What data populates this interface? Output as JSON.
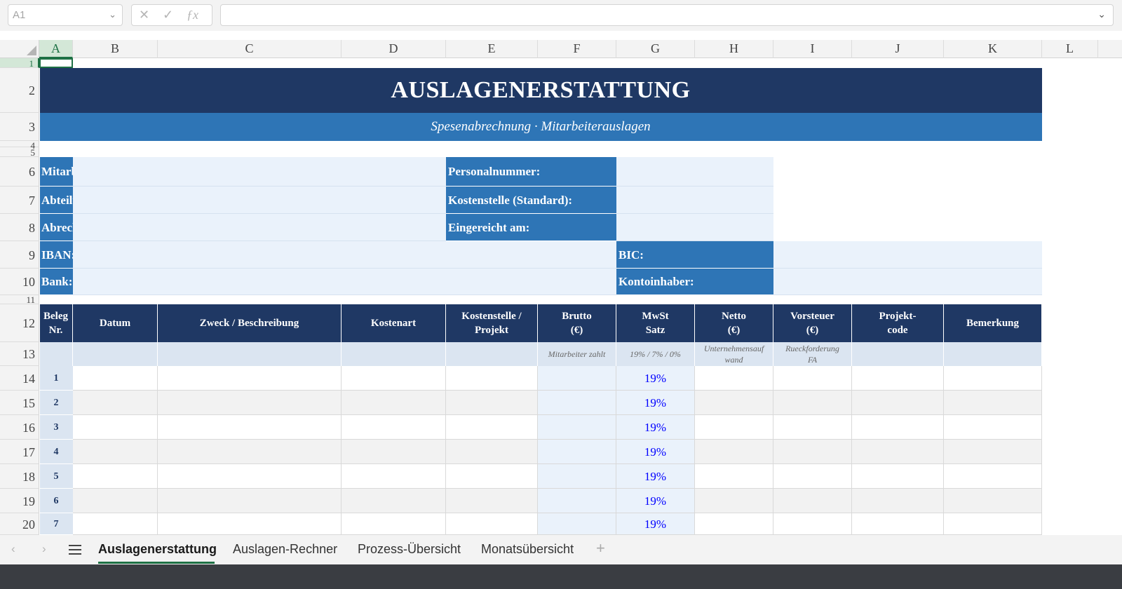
{
  "formula_bar": {
    "cell_ref": "A1",
    "formula": ""
  },
  "columns": [
    "A",
    "B",
    "C",
    "D",
    "E",
    "F",
    "G",
    "H",
    "I",
    "J",
    "K",
    "L"
  ],
  "rows": [
    "1",
    "2",
    "3",
    "4",
    "5",
    "6",
    "7",
    "8",
    "9",
    "10",
    "11",
    "12",
    "13",
    "14",
    "15",
    "16",
    "17",
    "18",
    "19",
    "20"
  ],
  "sheet": {
    "title": "AUSLAGENERSTATTUNG",
    "subtitle": "Spesenabrechnung · Mitarbeiterauslagen",
    "labels": {
      "name": "Mitarbeiter / Name:",
      "personalnummer": "Personalnummer:",
      "abteilung": "Abteilung:",
      "kostenstelle": "Kostenstelle (Standard):",
      "zeitraum": "Abrechnungszeitraum",
      "eingereicht": "Eingereicht am:",
      "iban": "IBAN:",
      "bic": "BIC:",
      "bank": "Bank:",
      "kontoinhaber": "Kontoinhaber:"
    },
    "table_headers": [
      [
        "Beleg",
        "Nr."
      ],
      [
        "Datum"
      ],
      [
        "Zweck / Beschreibung"
      ],
      [
        "Kostenart"
      ],
      [
        "Kostenstelle /",
        "Projekt"
      ],
      [
        "Brutto",
        "(€)"
      ],
      [
        "MwSt",
        "Satz"
      ],
      [
        "Netto",
        "(€)"
      ],
      [
        "Vorsteuer",
        "(€)"
      ],
      [
        "Projekt-",
        "code"
      ],
      [
        "Bemerkung"
      ]
    ],
    "hints": {
      "brutto": "Mitarbeiter zahlt",
      "mwst": "19% / 7% / 0%",
      "netto": [
        "Unternehmensauf",
        "wand"
      ],
      "vorsteuer": [
        "Rueckforderung",
        "FA"
      ]
    },
    "entries": [
      {
        "nr": "1",
        "rate": "19%"
      },
      {
        "nr": "2",
        "rate": "19%"
      },
      {
        "nr": "3",
        "rate": "19%"
      },
      {
        "nr": "4",
        "rate": "19%"
      },
      {
        "nr": "5",
        "rate": "19%"
      },
      {
        "nr": "6",
        "rate": "19%"
      },
      {
        "nr": "7",
        "rate": "19%"
      }
    ]
  },
  "tabs": [
    "Auslagenerstattung",
    "Auslagen-Rechner",
    "Prozess-Übersicht",
    "Monatsübersicht"
  ],
  "active_tab": "Auslagenerstattung",
  "colors": {
    "navy": "#1f3864",
    "blue": "#2e75b6",
    "input": "#eaf2fb",
    "accent_green": "#1e7145",
    "rate_text": "#0000ff"
  }
}
